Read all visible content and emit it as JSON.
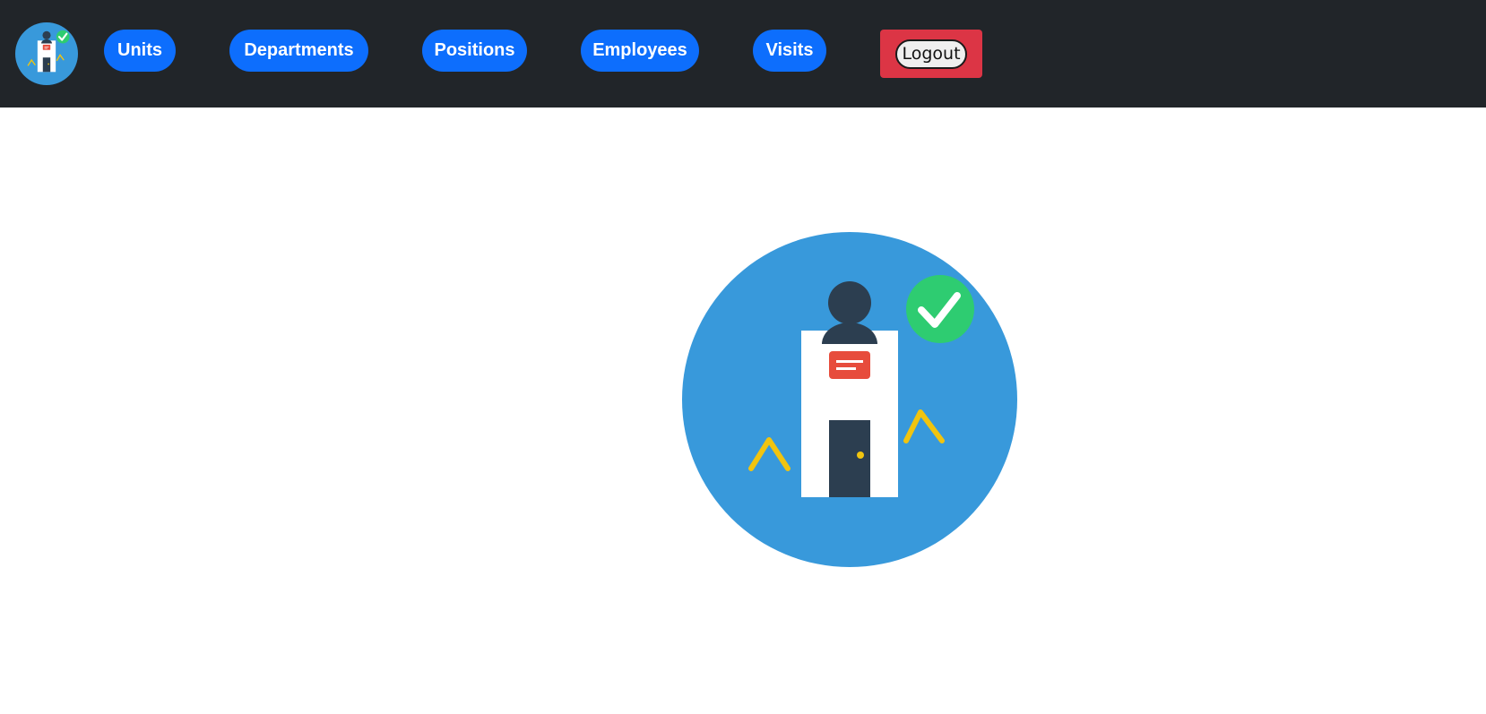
{
  "nav": {
    "items": [
      {
        "label": "Units"
      },
      {
        "label": "Departments"
      },
      {
        "label": "Positions"
      },
      {
        "label": "Employees"
      },
      {
        "label": "Visits"
      }
    ],
    "logout_label": "Logout"
  },
  "colors": {
    "navbar_bg": "#212529",
    "nav_button": "#0d6efd",
    "logout_bg": "#dc3545",
    "illustration_circle": "#3899db",
    "check_badge": "#2ecc71",
    "person": "#2c3e50",
    "id_badge": "#e74c3c",
    "arrows": "#f1c40f"
  },
  "icons": {
    "logo": "visitor-check-in-icon",
    "hero": "visitor-check-in-illustration"
  }
}
